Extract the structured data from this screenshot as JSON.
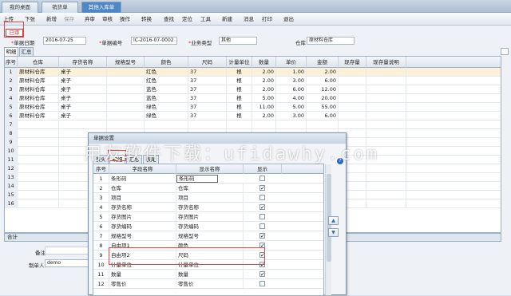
{
  "tabs": [
    "我的桌面",
    "销货单",
    "其他入库单"
  ],
  "toolbar": [
    "上传",
    "下张",
    "新增",
    "保存",
    "弃审",
    "审核",
    "操作",
    "转换",
    "查找",
    "定位",
    "工具",
    "新建",
    "消息",
    "打印",
    "退出"
  ],
  "status_badge": "已审",
  "form": {
    "date_label": "单据日期",
    "date_value": "2016-07-25",
    "no_label": "单据编号",
    "no_value": "IC-2016-07-0002",
    "type_label": "业务类型",
    "type_value": "其他",
    "wh_label": "仓库",
    "wh_value": "原材料仓库"
  },
  "subtabs": [
    "明细",
    "汇总"
  ],
  "grid": {
    "headers": [
      "序号",
      "仓库",
      "存货名称",
      "规格型号",
      "颜色",
      "尺码",
      "计量单位",
      "数量",
      "单价",
      "金额",
      "现存量",
      "现存量说明"
    ],
    "rows": [
      [
        "1",
        "原材料仓库",
        "桌子",
        "",
        "红色",
        "37",
        "根",
        "2.00",
        "1.00",
        "2.00"
      ],
      [
        "2",
        "原材料仓库",
        "桌子",
        "",
        "红色",
        "37",
        "根",
        "2.00",
        "3.00",
        "6.00"
      ],
      [
        "3",
        "原材料仓库",
        "桌子",
        "",
        "蓝色",
        "37",
        "根",
        "2.00",
        "6.00",
        "12.00"
      ],
      [
        "4",
        "原材料仓库",
        "桌子",
        "",
        "蓝色",
        "37",
        "根",
        "5.00",
        "4.00",
        "20.00"
      ],
      [
        "5",
        "原材料仓库",
        "桌子",
        "",
        "绿色",
        "37",
        "根",
        "11.00",
        "5.00",
        "55.00"
      ],
      [
        "6",
        "原材料仓库",
        "桌子",
        "",
        "绿色",
        "37",
        "根",
        "2.00",
        "3.00",
        "6.00"
      ],
      [
        "7",
        "",
        "",
        "",
        "",
        "",
        "",
        "",
        "",
        ""
      ],
      [
        "8",
        "",
        "",
        "",
        "",
        "",
        "",
        "",
        "",
        ""
      ],
      [
        "9",
        "",
        "",
        "",
        "",
        "",
        "",
        "",
        "",
        ""
      ],
      [
        "10",
        "",
        "",
        "",
        "",
        "",
        "",
        "",
        "",
        ""
      ],
      [
        "11",
        "",
        "",
        "",
        "",
        "",
        "",
        "",
        "",
        ""
      ],
      [
        "12",
        "",
        "",
        "",
        "",
        "",
        "",
        "",
        "",
        ""
      ],
      [
        "13",
        "",
        "",
        "",
        "",
        "",
        "",
        "",
        "",
        ""
      ],
      [
        "14",
        "",
        "",
        "",
        "",
        "",
        "",
        "",
        "",
        ""
      ],
      [
        "15",
        "",
        "",
        "",
        "",
        "",
        "",
        "",
        "",
        ""
      ],
      [
        "16",
        "",
        "",
        "",
        "",
        "",
        "",
        "",
        "",
        ""
      ]
    ]
  },
  "sum_label": "合计",
  "footer": {
    "remark_label": "备注",
    "maker_label": "制单人",
    "maker_value": "demo"
  },
  "dialog": {
    "title": "单据设置",
    "tabs": [
      "表头",
      "明细",
      "汇总",
      "表尾"
    ],
    "headers": [
      "序号",
      "字段名称",
      "显示名称",
      "显示"
    ],
    "rows": [
      [
        "1",
        "条形码",
        "条形码",
        false
      ],
      [
        "2",
        "仓库",
        "仓库",
        true
      ],
      [
        "3",
        "项目",
        "项目",
        false
      ],
      [
        "4",
        "存货名称",
        "存货名称",
        true
      ],
      [
        "5",
        "存货图片",
        "存货图片",
        false
      ],
      [
        "6",
        "存货编码",
        "存货编码",
        false
      ],
      [
        "7",
        "规格型号",
        "规格型号",
        true
      ],
      [
        "8",
        "自由项1",
        "颜色",
        true
      ],
      [
        "9",
        "自由项2",
        "尺码",
        true
      ],
      [
        "10",
        "计量单位",
        "计量单位",
        true
      ],
      [
        "11",
        "数量",
        "数量",
        true
      ],
      [
        "12",
        "零售价",
        "零售价",
        false
      ]
    ]
  },
  "watermark": "用友软件下载：ufidawhy.com"
}
